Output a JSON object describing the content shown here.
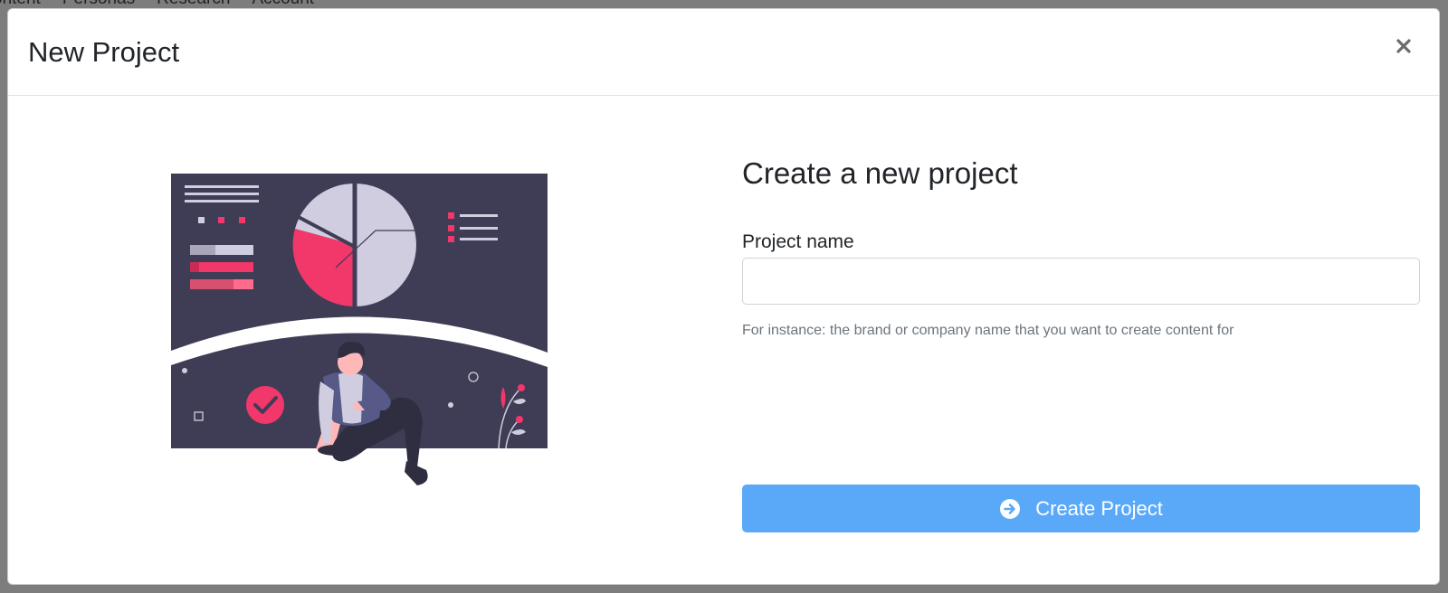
{
  "background_nav": {
    "items": [
      "ontent",
      "Personas",
      "Research",
      "Account"
    ]
  },
  "modal": {
    "title": "New Project",
    "close_icon": "close-icon"
  },
  "form": {
    "heading": "Create a new project",
    "project_name_label": "Project name",
    "project_name_value": "",
    "project_name_placeholder": "",
    "help_text": "For instance: the brand or company name that you want to create content for",
    "submit_label": "Create Project",
    "submit_icon": "arrow-circle-right-icon"
  },
  "colors": {
    "primary_button": "#5aa9f9",
    "illustration_dark": "#3f3d56",
    "illustration_accent": "#f2376b",
    "illustration_light": "#d0cde1"
  }
}
